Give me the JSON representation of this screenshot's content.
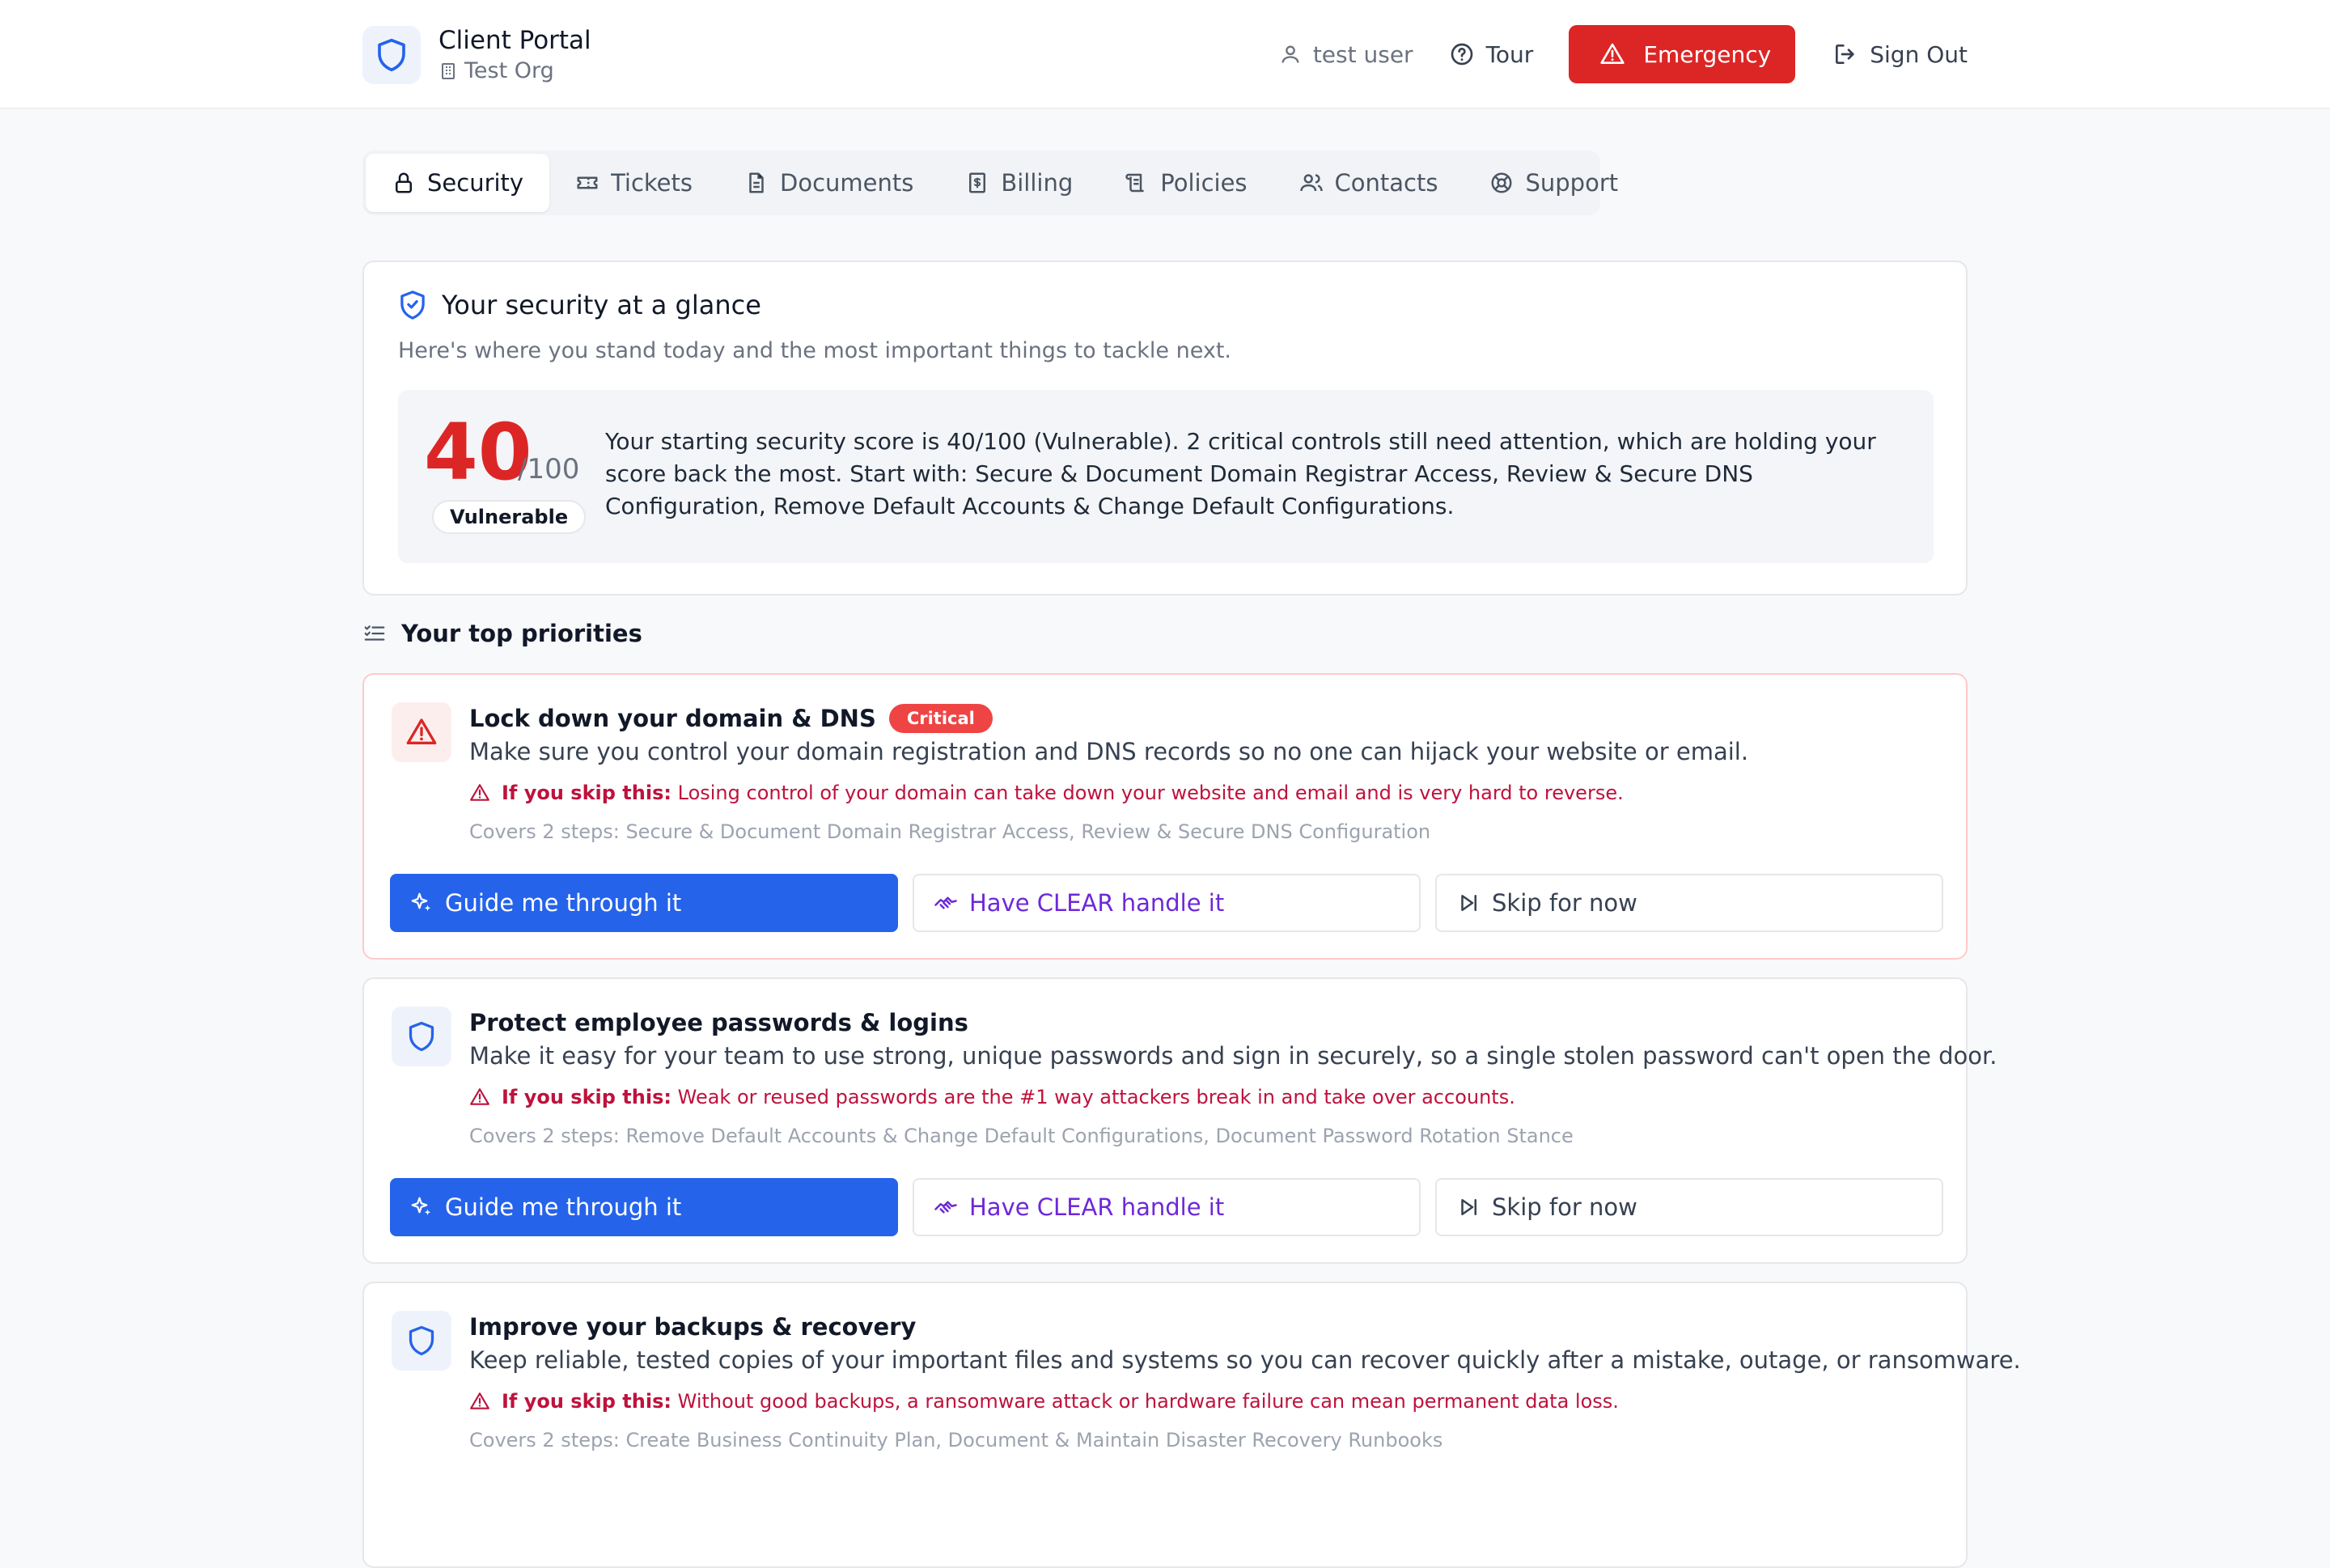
{
  "header": {
    "title": "Client Portal",
    "org": "Test Org",
    "user": "test user",
    "tour_label": "Tour",
    "emergency_label": "Emergency",
    "signout_label": "Sign Out"
  },
  "tabs": [
    {
      "label": "Security",
      "icon": "lock-icon",
      "active": true
    },
    {
      "label": "Tickets",
      "icon": "ticket-icon"
    },
    {
      "label": "Documents",
      "icon": "document-icon"
    },
    {
      "label": "Billing",
      "icon": "receipt-icon"
    },
    {
      "label": "Policies",
      "icon": "scroll-icon"
    },
    {
      "label": "Contacts",
      "icon": "users-icon"
    },
    {
      "label": "Support",
      "icon": "lifebuoy-icon"
    }
  ],
  "glance": {
    "title": "Your security at a glance",
    "subtitle": "Here's where you stand today and the most important things to tackle next.",
    "score": "40",
    "score_max": "/100",
    "status": "Vulnerable",
    "summary": "Your starting security score is 40/100 (Vulnerable). 2 critical controls still need attention, which are holding your score back the most. Start with: Secure & Document Domain Registrar Access, Review & Secure DNS Configuration, Remove Default Accounts & Change Default Configurations."
  },
  "priorities": {
    "heading": "Your top priorities",
    "warn_prefix": "If you skip this:",
    "guide_label": "Guide me through it",
    "clear_label": "Have CLEAR handle it",
    "skip_label": "Skip for now",
    "items": [
      {
        "title": "Lock down your domain & DNS",
        "badge": "Critical",
        "description": "Make sure you control your domain registration and DNS records so no one can hijack your website or email.",
        "warning": "Losing control of your domain can take down your website and email and is very hard to reverse.",
        "covers": "Covers 2 steps: Secure & Document Domain Registrar Access, Review & Secure DNS Configuration"
      },
      {
        "title": "Protect employee passwords & logins",
        "description": "Make it easy for your team to use strong, unique passwords and sign in securely, so a single stolen password can't open the door.",
        "warning": "Weak or reused passwords are the #1 way attackers break in and take over accounts.",
        "covers": "Covers 2 steps: Remove Default Accounts & Change Default Configurations, Document Password Rotation Stance"
      },
      {
        "title": "Improve your backups & recovery",
        "description": "Keep reliable, tested copies of your important files and systems so you can recover quickly after a mistake, outage, or ransomware.",
        "warning": "Without good backups, a ransomware attack or hardware failure can mean permanent data loss.",
        "covers": "Covers 2 steps: Create Business Continuity Plan, Document & Maintain Disaster Recovery Runbooks"
      }
    ]
  },
  "colors": {
    "primary": "#2563eb",
    "danger": "#dc2626",
    "clear_purple": "#6d28d9"
  }
}
